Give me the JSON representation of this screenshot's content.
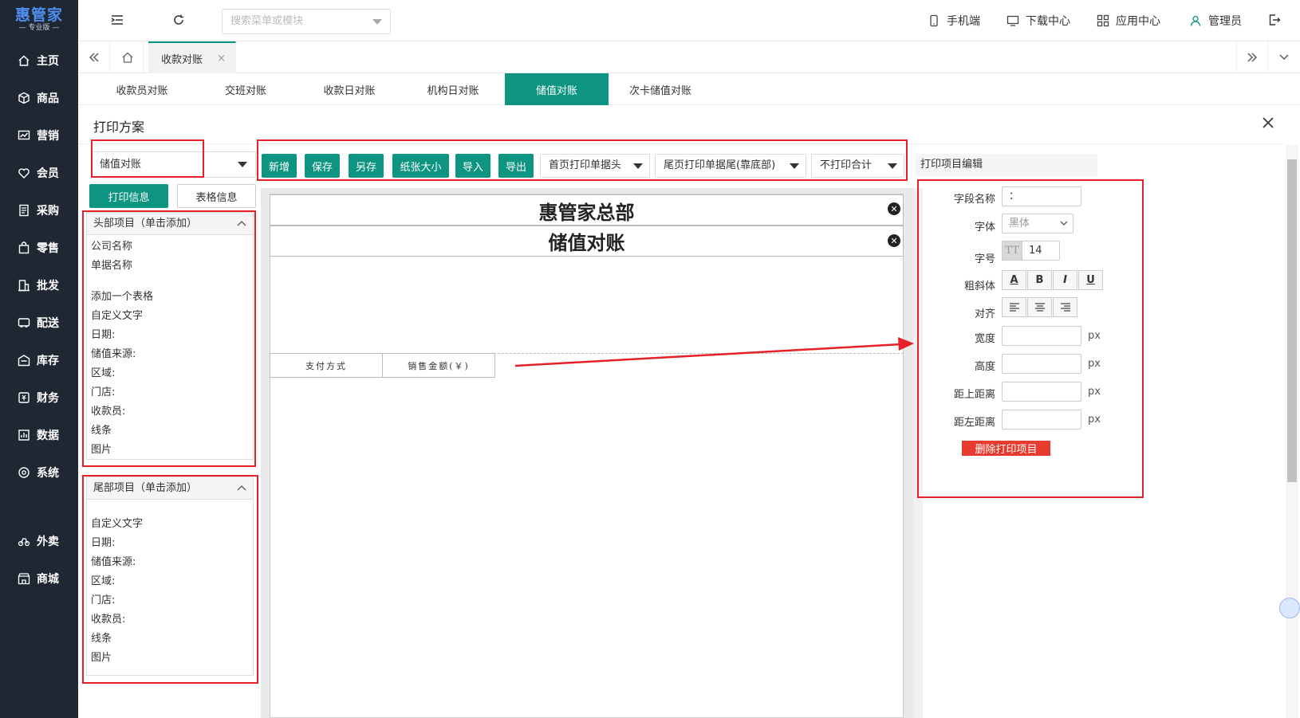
{
  "app": {
    "logo_main": "惠管家",
    "logo_sub": "— 专业版 —"
  },
  "sidebar": {
    "items": [
      {
        "label": "主页",
        "icon": "home-icon"
      },
      {
        "label": "商品",
        "icon": "box-icon"
      },
      {
        "label": "营销",
        "icon": "chart-icon"
      },
      {
        "label": "会员",
        "icon": "heart-icon"
      },
      {
        "label": "采购",
        "icon": "receipt-icon"
      },
      {
        "label": "零售",
        "icon": "shopping-bag-icon"
      },
      {
        "label": "批发",
        "icon": "building-icon"
      },
      {
        "label": "配送",
        "icon": "delivery-icon"
      },
      {
        "label": "库存",
        "icon": "warehouse-icon"
      },
      {
        "label": "财务",
        "icon": "money-icon"
      },
      {
        "label": "数据",
        "icon": "data-icon"
      },
      {
        "label": "系统",
        "icon": "settings-icon"
      },
      {
        "label": "外卖",
        "icon": "bike-icon"
      },
      {
        "label": "商城",
        "icon": "store-icon"
      }
    ]
  },
  "topbar": {
    "search_placeholder": "搜索菜单或模块",
    "links": [
      {
        "label": "手机端",
        "icon": "mobile-icon"
      },
      {
        "label": "下载中心",
        "icon": "download-icon"
      },
      {
        "label": "应用中心",
        "icon": "apps-icon"
      },
      {
        "label": "管理员",
        "icon": "user-icon"
      }
    ]
  },
  "page_tab": {
    "label": "收款对账"
  },
  "subtabs": [
    {
      "label": "收款员对账",
      "active": false
    },
    {
      "label": "交班对账",
      "active": false
    },
    {
      "label": "收款日对账",
      "active": false
    },
    {
      "label": "机构日对账",
      "active": false
    },
    {
      "label": "储值对账",
      "active": true
    },
    {
      "label": "次卡储值对账",
      "active": false
    }
  ],
  "panel": {
    "title": "打印方案"
  },
  "left": {
    "scheme_value": "储值对账",
    "tab_print_info": "打印信息",
    "tab_table_info": "表格信息",
    "header_group": {
      "title": "头部项目（单击添加）",
      "items_a": [
        "公司名称",
        "单据名称"
      ],
      "items_b": [
        "添加一个表格",
        "自定义文字",
        "日期:",
        "储值来源:",
        "区域:",
        "门店:",
        "收款员:",
        "线条",
        "图片"
      ]
    },
    "footer_group": {
      "title": "尾部项目（单击添加）",
      "items": [
        "自定义文字",
        "日期:",
        "储值来源:",
        "区域:",
        "门店:",
        "收款员:",
        "线条",
        "图片"
      ]
    }
  },
  "toolbar": {
    "buttons": [
      "新增",
      "保存",
      "另存",
      "纸张大小",
      "导入",
      "导出"
    ],
    "header_select": "首页打印单据头",
    "footer_select": "尾页打印单据尾(靠底部)",
    "total_select": "不打印合计"
  },
  "canvas": {
    "company": "惠管家总部",
    "doc_title": "储值对账",
    "table_headers": [
      "支付方式",
      "销售金额(￥)"
    ]
  },
  "right": {
    "header": "打印项目编辑",
    "field_name_label": "字段名称",
    "field_name_value": "：",
    "font_label": "字体",
    "font_value": "黑体",
    "size_label": "字号",
    "size_value": "14",
    "size_icon_text": "TT",
    "style_label": "粗斜体",
    "style_buttons": [
      "A",
      "B",
      "I",
      "U"
    ],
    "align_label": "对齐",
    "width_label": "宽度",
    "height_label": "高度",
    "top_label": "距上距离",
    "left_label": "距左距离",
    "unit": "px",
    "delete_label": "删除打印项目"
  },
  "colors": {
    "sidebar": "#1f2733",
    "accent": "#0e9582",
    "danger": "#e63b2e",
    "annotation": "#e8202a"
  }
}
